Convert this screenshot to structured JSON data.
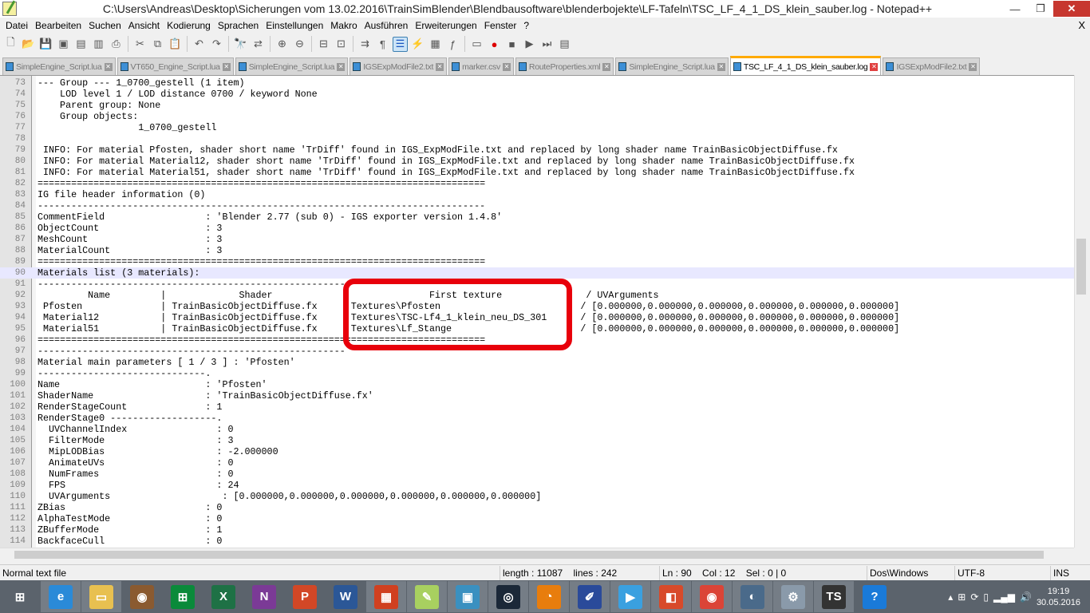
{
  "window": {
    "title": "C:\\Users\\Andreas\\Desktop\\Sicherungen vom 13.02.2016\\TrainSimBlender\\Blendbausoftware\\blenderbojekte\\LF-Tafeln\\TSC_LF_4_1_DS_klein_sauber.log - Notepad++",
    "minimize": "—",
    "restore": "❐",
    "close": "✕"
  },
  "menu": {
    "items": [
      "Datei",
      "Bearbeiten",
      "Suchen",
      "Ansicht",
      "Kodierung",
      "Sprachen",
      "Einstellungen",
      "Makro",
      "Ausführen",
      "Erweiterungen",
      "Fenster",
      "?"
    ],
    "close": "X"
  },
  "toolbar": [
    "new-file",
    "open",
    "save",
    "save-all",
    "close",
    "close-all",
    "print",
    "cut",
    "copy",
    "paste",
    "undo",
    "redo",
    "find",
    "replace",
    "zoom-in",
    "zoom-out",
    "sync-v",
    "sync-h",
    "word-wrap",
    "show-all-chars",
    "indent-guide",
    "udl",
    "doc-map",
    "function-list",
    "folder-workspace",
    "record-macro",
    "stop-macro",
    "play-macro",
    "run-macro-multiple",
    "save-macro"
  ],
  "tabs": [
    {
      "label": "SimpleEngine_Script.lua",
      "active": false
    },
    {
      "label": "VT650_Engine_Script.lua",
      "active": false
    },
    {
      "label": "SimpleEngine_Script.lua",
      "active": false
    },
    {
      "label": "IGSExpModFile2.txt",
      "active": false
    },
    {
      "label": "marker.csv",
      "active": false
    },
    {
      "label": "RouteProperties.xml",
      "active": false
    },
    {
      "label": "SimpleEngine_Script.lua",
      "active": false
    },
    {
      "label": "TSC_LF_4_1_DS_klein_sauber.log",
      "active": true
    },
    {
      "label": "IGSExpModFile2.txt",
      "active": false
    }
  ],
  "editor": {
    "current_line": 90,
    "highlight_color": "#e8000b",
    "lines": [
      {
        "n": "73",
        "t": "--- Group --- 1_0700_gestell (1 item)"
      },
      {
        "n": "74",
        "t": "    LOD level 1 / LOD distance 0700 / keyword None"
      },
      {
        "n": "75",
        "t": "    Parent group: None"
      },
      {
        "n": "76",
        "t": "    Group objects:"
      },
      {
        "n": "77",
        "t": "                  1_0700_gestell"
      },
      {
        "n": "78",
        "t": ""
      },
      {
        "n": "79",
        "t": " INFO: For material Pfosten, shader short name 'TrDiff' found in IGS_ExpModFile.txt and replaced by long shader name TrainBasicObjectDiffuse.fx"
      },
      {
        "n": "80",
        "t": " INFO: For material Material12, shader short name 'TrDiff' found in IGS_ExpModFile.txt and replaced by long shader name TrainBasicObjectDiffuse.fx"
      },
      {
        "n": "81",
        "t": " INFO: For material Material51, shader short name 'TrDiff' found in IGS_ExpModFile.txt and replaced by long shader name TrainBasicObjectDiffuse.fx"
      },
      {
        "n": "82",
        "t": "================================================================================"
      },
      {
        "n": "83",
        "t": "IG file header information (0)"
      },
      {
        "n": "84",
        "t": "--------------------------------------------------------------------------------"
      },
      {
        "n": "85",
        "t": "CommentField                  : 'Blender 2.77 (sub 0) - IGS exporter version 1.4.8'"
      },
      {
        "n": "86",
        "t": "ObjectCount                   : 3"
      },
      {
        "n": "87",
        "t": "MeshCount                     : 3"
      },
      {
        "n": "88",
        "t": "MaterialCount                 : 3"
      },
      {
        "n": "89",
        "t": "================================================================================"
      },
      {
        "n": "90",
        "t": "Materials list (3 materials):"
      },
      {
        "n": "91",
        "t": "-------------------------------------------------------"
      },
      {
        "n": "92",
        "t": "         Name         |             Shader                            First texture               / UVArguments"
      },
      {
        "n": "93",
        "t": " Pfosten              | TrainBasicObjectDiffuse.fx      Textures\\Pfosten                         / [0.000000,0.000000,0.000000,0.000000,0.000000,0.000000]"
      },
      {
        "n": "94",
        "t": " Material12           | TrainBasicObjectDiffuse.fx      Textures\\TSC-Lf4_1_klein_neu_DS_301      / [0.000000,0.000000,0.000000,0.000000,0.000000,0.000000]"
      },
      {
        "n": "95",
        "t": " Material51           | TrainBasicObjectDiffuse.fx      Textures\\Lf_Stange                       / [0.000000,0.000000,0.000000,0.000000,0.000000,0.000000]"
      },
      {
        "n": "96",
        "t": "================================================================================"
      },
      {
        "n": "97",
        "t": "-------------------------------------------------------"
      },
      {
        "n": "98",
        "t": "Material main parameters [ 1 / 3 ] : 'Pfosten'"
      },
      {
        "n": "99",
        "t": "------------------------------."
      },
      {
        "n": "100",
        "t": "Name                          : 'Pfosten'"
      },
      {
        "n": "101",
        "t": "ShaderName                    : 'TrainBasicObjectDiffuse.fx'"
      },
      {
        "n": "102",
        "t": "RenderStageCount              : 1"
      },
      {
        "n": "103",
        "t": "RenderStage0 -------------------."
      },
      {
        "n": "104",
        "t": "  UVChannelIndex                : 0"
      },
      {
        "n": "105",
        "t": "  FilterMode                    : 3"
      },
      {
        "n": "106",
        "t": "  MipLODBias                    : -2.000000"
      },
      {
        "n": "107",
        "t": "  AnimateUVs                    : 0"
      },
      {
        "n": "108",
        "t": "  NumFrames                     : 0"
      },
      {
        "n": "109",
        "t": "  FPS                           : 24"
      },
      {
        "n": "110",
        "t": "  UVArguments                    : [0.000000,0.000000,0.000000,0.000000,0.000000,0.000000]"
      },
      {
        "n": "111",
        "t": "ZBias                         : 0"
      },
      {
        "n": "112",
        "t": "AlphaTestMode                 : 0"
      },
      {
        "n": "113",
        "t": "ZBufferMode                   : 1"
      },
      {
        "n": "114",
        "t": "BackfaceCull                  : 0"
      }
    ]
  },
  "status": {
    "type": "Normal text file",
    "length": "length : 11087    lines : 242",
    "position": "Ln : 90    Col : 12    Sel : 0 | 0",
    "eol": "Dos\\Windows",
    "encoding": "UTF-8",
    "mode": "INS"
  },
  "taskbar": {
    "apps": [
      {
        "name": "start",
        "glyph": "⊞",
        "color": "#5b636c",
        "open": false
      },
      {
        "name": "internet-explorer",
        "glyph": "e",
        "color": "#2a8ad8",
        "open": true
      },
      {
        "name": "file-explorer",
        "glyph": "▭",
        "color": "#e8c050",
        "open": true
      },
      {
        "name": "speaker-app",
        "glyph": "◉",
        "color": "#8a5a30",
        "open": false
      },
      {
        "name": "store",
        "glyph": "⊞",
        "color": "#0a8a3a",
        "open": false
      },
      {
        "name": "excel",
        "glyph": "X",
        "color": "#1e7145",
        "open": false
      },
      {
        "name": "onenote",
        "glyph": "N",
        "color": "#7b3a96",
        "open": false
      },
      {
        "name": "powerpoint",
        "glyph": "P",
        "color": "#d24726",
        "open": false
      },
      {
        "name": "word",
        "glyph": "W",
        "color": "#2b5797",
        "open": false
      },
      {
        "name": "office-app",
        "glyph": "▦",
        "color": "#d04020",
        "open": true
      },
      {
        "name": "notepad-plus-plus",
        "glyph": "✎",
        "color": "#a8d060",
        "open": true
      },
      {
        "name": "photo-viewer",
        "glyph": "▣",
        "color": "#3a90c0",
        "open": true
      },
      {
        "name": "steam",
        "glyph": "◎",
        "color": "#1b2838",
        "open": true
      },
      {
        "name": "blender",
        "glyph": "◔",
        "color": "#e87d0d",
        "open": true
      },
      {
        "name": "paint-app",
        "glyph": "✐",
        "color": "#2a4a9a",
        "open": true
      },
      {
        "name": "media-player",
        "glyph": "▶",
        "color": "#3aa0e0",
        "open": true
      },
      {
        "name": "app-red",
        "glyph": "◧",
        "color": "#d84a2a",
        "open": true
      },
      {
        "name": "chrome",
        "glyph": "◉",
        "color": "#db4437",
        "open": true
      },
      {
        "name": "teamspeak",
        "glyph": "◐",
        "color": "#4a6a8a",
        "open": true
      },
      {
        "name": "settings",
        "glyph": "⚙",
        "color": "#8a9aaa",
        "open": true
      },
      {
        "name": "train-simulator",
        "glyph": "TS",
        "color": "#333",
        "open": true
      },
      {
        "name": "help",
        "glyph": "?",
        "color": "#1a7ad8",
        "open": false
      }
    ],
    "tray": [
      "▴",
      "⊞",
      "⟳",
      "▯",
      "▂▄▆",
      "🔊"
    ],
    "time": "19:19",
    "date": "30.05.2016"
  }
}
